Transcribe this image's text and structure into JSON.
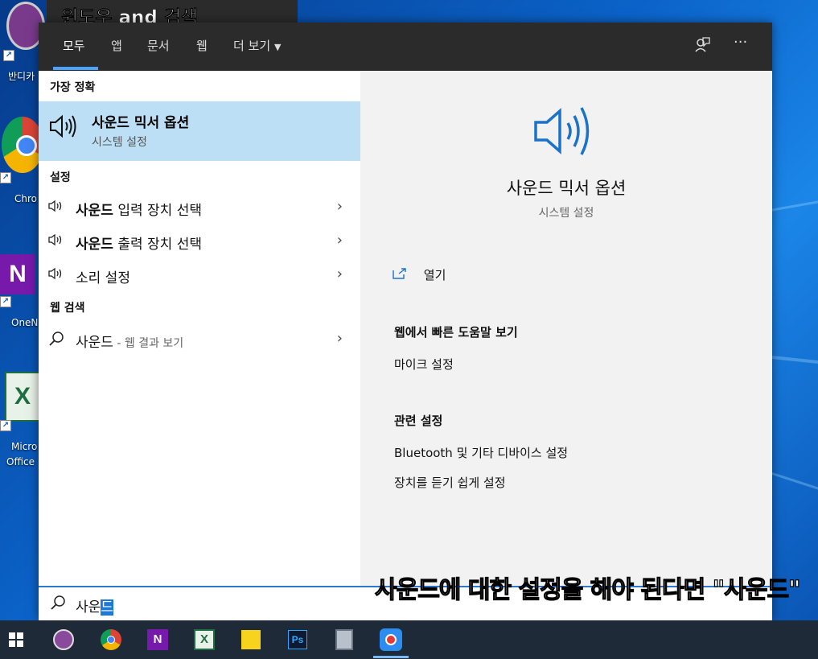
{
  "video_title": "윈도우 and 검색",
  "desktop": {
    "icons": [
      {
        "label": "반디카"
      },
      {
        "label": "Chro"
      },
      {
        "label": "OneN"
      },
      {
        "label": "Micro"
      },
      {
        "label": "Office"
      }
    ]
  },
  "tabs": [
    "모두",
    "앱",
    "문서",
    "웹",
    "더 보기"
  ],
  "top_icons": {
    "feedback": "feedback-icon",
    "more": "···"
  },
  "left": {
    "best_match_header": "가장 정확",
    "best_match": {
      "name": "사운드 믹서 옵션",
      "sub": "시스템 설정"
    },
    "settings_header": "설정",
    "settings_items": [
      {
        "bold": "사운드",
        "rest": " 입력 장치 선택"
      },
      {
        "bold": "사운드",
        "rest": " 출력 장치 선택"
      },
      {
        "bold": "",
        "rest": "소리 설정"
      }
    ],
    "web_header": "웹 검색",
    "web_item": {
      "bold": "사운드",
      "hint": " - 웹 결과 보기"
    }
  },
  "right": {
    "title": "사운드 믹서 옵션",
    "sub": "시스템 설정",
    "open_label": "열기",
    "help_header": "웹에서 빠른 도움말 보기",
    "help_link": "마이크 설정",
    "related_header": "관련 설정",
    "related_links": [
      "Bluetooth 및 기타 디바이스 설정",
      "장치를 듣기 쉽게 설정"
    ]
  },
  "search": {
    "typed": "사운",
    "selected": "드"
  },
  "subtitle": "사운드에 대한 설정을 해야 된다면 \"사운드\"",
  "colors": {
    "accent": "#1e78d6",
    "highlight": "#bddff5",
    "topbar": "#2b2b2b",
    "taskbar": "#1f2a38"
  }
}
